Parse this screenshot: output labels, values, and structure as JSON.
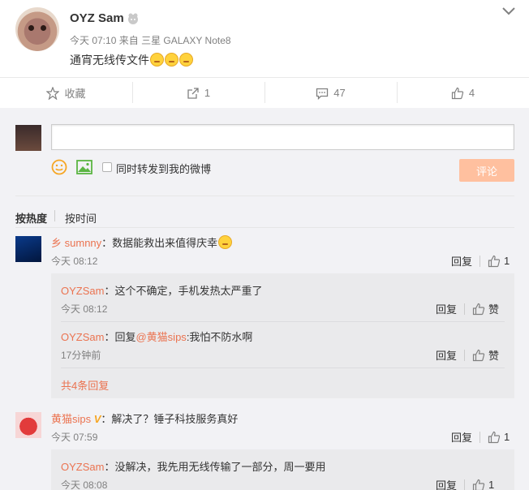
{
  "post": {
    "username": "OYZ Sam",
    "time": "今天 07:10",
    "source_prefix": "来自",
    "source": "三星 GALAXY Note8",
    "text": "通宵无线传文件"
  },
  "actions": {
    "favorite": "收藏",
    "repost": "1",
    "comments": "47",
    "likes": "4"
  },
  "composer": {
    "input_value": "",
    "forward_label": "同时转发到我的微博",
    "submit": "评论"
  },
  "sort": {
    "hot": "按热度",
    "time": "按时间"
  },
  "comments": [
    {
      "prefix": "乡",
      "name": "sumnny",
      "text": "：数据能救出来值得庆幸",
      "time": "今天 08:12",
      "reply": "回复",
      "likes": "1",
      "replies": [
        {
          "name": "OYZSam",
          "text": "：这个不确定，手机发热太严重了",
          "time": "今天 08:12",
          "reply": "回复",
          "like": "赞"
        },
        {
          "name": "OYZSam",
          "text_prefix": "：回复",
          "mention": "@黄猫sips",
          "text": ":我怕不防水啊",
          "time": "17分钟前",
          "reply": "回复",
          "like": "赞"
        }
      ],
      "more": "共4条回复"
    },
    {
      "name": "黄猫sips",
      "badge": "V",
      "text": "：解决了？锤子科技服务真好",
      "time": "今天 07:59",
      "reply": "回复",
      "likes": "1",
      "replies": [
        {
          "name": "OYZSam",
          "text": "：没解决，我先用无线传输了一部分，周一要用",
          "time": "今天 08:08",
          "reply": "回复",
          "likes": "1"
        }
      ]
    }
  ],
  "colors": {
    "accent": "#eb7350",
    "submit_bg": "#ffc09f",
    "panel_bg": "#f2f2f5",
    "reply_bg": "#eaeaec"
  }
}
